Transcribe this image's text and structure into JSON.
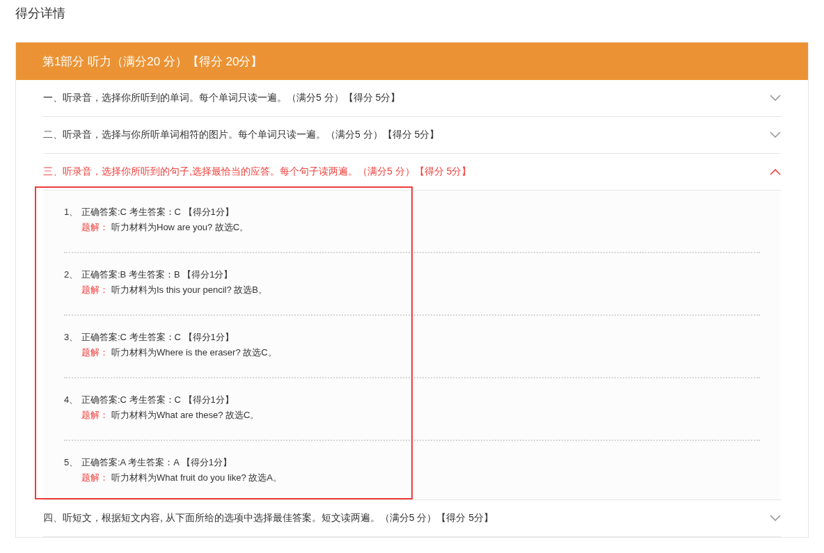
{
  "page_title": "得分详情",
  "part": {
    "title": "第1部分 听力（满分20 分）【得分 20分】"
  },
  "sections": [
    {
      "title": "一、听录音，选择你所听到的单词。每个单词只读一遍。（满分5 分）【得分 5分】",
      "expanded": false
    },
    {
      "title": "二、听录音，选择与你所听单词相符的图片。每个单词只读一遍。（满分5 分）【得分 5分】",
      "expanded": false
    },
    {
      "title": "三、听录音，选择你所听到的句子,选择最恰当的应答。每个句子读两遍。（满分5 分）【得分 5分】",
      "expanded": true,
      "highlighted": true,
      "answers": [
        {
          "number": "1、",
          "result": "正确答案:C 考生答案：C 【得分1分】",
          "label": "题解：",
          "explanation": "听力材料为How are you? 故选C。"
        },
        {
          "number": "2、",
          "result": "正确答案:B 考生答案：B 【得分1分】",
          "label": "题解：",
          "explanation": "听力材料为Is this your pencil? 故选B。"
        },
        {
          "number": "3、",
          "result": "正确答案:C 考生答案：C 【得分1分】",
          "label": "题解：",
          "explanation": "听力材料为Where is the eraser? 故选C。"
        },
        {
          "number": "4、",
          "result": "正确答案:C 考生答案：C 【得分1分】",
          "label": "题解：",
          "explanation": "听力材料为What are these? 故选C。"
        },
        {
          "number": "5、",
          "result": "正确答案:A 考生答案：A 【得分1分】",
          "label": "题解：",
          "explanation": "听力材料为What fruit do you like? 故选A。"
        }
      ]
    },
    {
      "title": "四、听短文，根据短文内容, 从下面所给的选项中选择最佳答案。短文读两遍。（满分5 分）【得分 5分】",
      "expanded": false
    }
  ]
}
